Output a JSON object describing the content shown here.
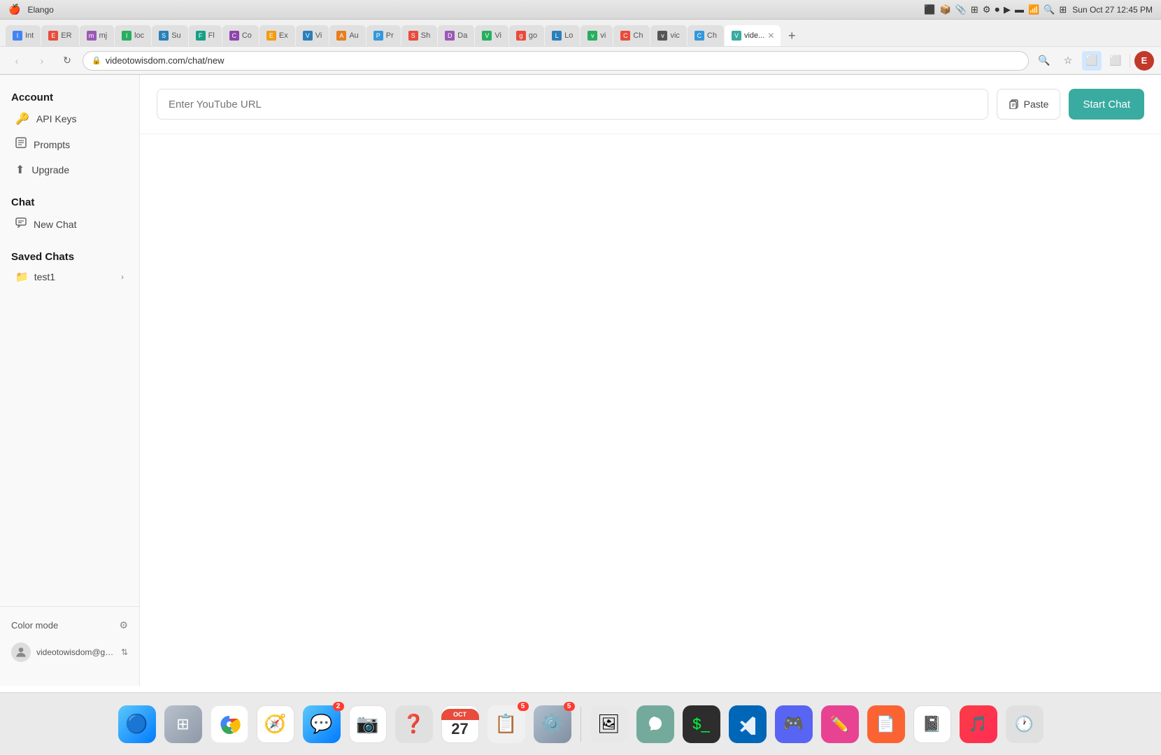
{
  "os": {
    "topbar": {
      "apple": "🍎",
      "datetime": "Sun Oct 27  12:45 PM",
      "wifi_icon": "wifi",
      "battery_icon": "battery"
    }
  },
  "browser": {
    "tabs": [
      {
        "label": "Int",
        "color": "#4285f4",
        "active": false
      },
      {
        "label": "ER",
        "color": "#e74c3c",
        "active": false
      },
      {
        "label": "mj",
        "color": "#9b59b6",
        "active": false
      },
      {
        "label": "loc",
        "color": "#27ae60",
        "active": false
      },
      {
        "label": "Su",
        "color": "#2980b9",
        "active": false
      },
      {
        "label": "Fl",
        "color": "#16a085",
        "active": false
      },
      {
        "label": "Co",
        "color": "#8e44ad",
        "active": false
      },
      {
        "label": "Ex",
        "color": "#f39c12",
        "active": false
      },
      {
        "label": "Vi",
        "color": "#2980b9",
        "active": false
      },
      {
        "label": "Au",
        "color": "#e67e22",
        "active": false
      },
      {
        "label": "Pr",
        "color": "#3498db",
        "active": false
      },
      {
        "label": "Sh",
        "color": "#e74c3c",
        "active": false
      },
      {
        "label": "Da",
        "color": "#9b59b6",
        "active": false
      },
      {
        "label": "Vi",
        "color": "#27ae60",
        "active": false
      },
      {
        "label": "go",
        "color": "#e74c3c",
        "active": false
      },
      {
        "label": "Lo",
        "color": "#2980b9",
        "active": false
      },
      {
        "label": "vi",
        "color": "#27ae60",
        "active": false
      },
      {
        "label": "Ch",
        "color": "#e74c3c",
        "active": false
      },
      {
        "label": "vic",
        "color": "#333",
        "active": false
      },
      {
        "label": "Ch",
        "color": "#3498db",
        "active": false
      },
      {
        "label": "✕",
        "color": "#999",
        "active": true,
        "isActive": true
      }
    ],
    "url": "videotowisdom.com/chat/new",
    "url_display": "videotowisdom.com/chat/new"
  },
  "sidebar": {
    "account_section": "Account",
    "api_keys_label": "API Keys",
    "prompts_label": "Prompts",
    "upgrade_label": "Upgrade",
    "chat_section": "Chat",
    "new_chat_label": "New Chat",
    "saved_chats_section": "Saved Chats",
    "test1_label": "test1",
    "color_mode_label": "Color mode",
    "user_email": "videotowisdom@gmail..."
  },
  "main": {
    "url_placeholder": "Enter YouTube URL",
    "paste_label": "Paste",
    "start_chat_label": "Start Chat"
  },
  "dock": {
    "items": [
      {
        "name": "finder",
        "emoji": "🔵",
        "label": "Finder"
      },
      {
        "name": "launchpad",
        "emoji": "⬛",
        "label": "Launchpad"
      },
      {
        "name": "chrome",
        "emoji": "🌐",
        "label": "Chrome"
      },
      {
        "name": "safari",
        "emoji": "🧭",
        "label": "Safari"
      },
      {
        "name": "messages",
        "emoji": "💬",
        "label": "Messages"
      },
      {
        "name": "photos",
        "emoji": "📷",
        "label": "Photos"
      },
      {
        "name": "help",
        "emoji": "❓",
        "label": "Help"
      },
      {
        "name": "calendar",
        "emoji": "📅",
        "label": "Calendar"
      },
      {
        "name": "reminders",
        "emoji": "📋",
        "label": "Reminders"
      },
      {
        "name": "chatgpt",
        "emoji": "🤖",
        "label": "ChatGPT"
      },
      {
        "name": "settings",
        "emoji": "⚙️",
        "label": "System Preferences"
      },
      {
        "name": "terminal",
        "emoji": "💻",
        "label": "Terminal"
      },
      {
        "name": "vscode",
        "emoji": "📝",
        "label": "VS Code"
      },
      {
        "name": "discord",
        "emoji": "🎮",
        "label": "Discord"
      },
      {
        "name": "affinity",
        "emoji": "✏️",
        "label": "Affinity"
      },
      {
        "name": "notion",
        "emoji": "📓",
        "label": "Notion"
      },
      {
        "name": "music",
        "emoji": "🎵",
        "label": "Music"
      },
      {
        "name": "dock-settings",
        "emoji": "⚙️",
        "label": "Settings"
      }
    ]
  }
}
